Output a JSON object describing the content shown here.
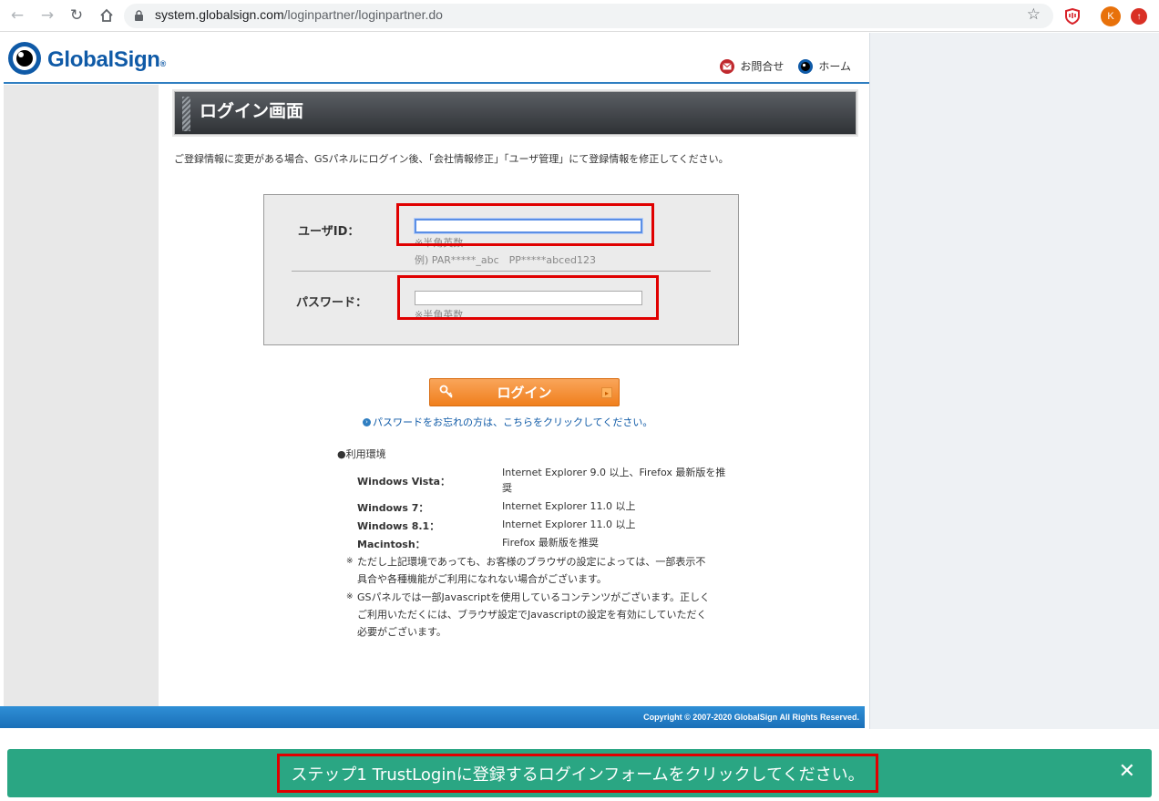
{
  "browser": {
    "url_domain": "system.globalsign.com",
    "url_path": "/loginpartner/loginpartner.do",
    "profile_initial": "K"
  },
  "header": {
    "logo_text": "GlobalSign",
    "logo_mark": "®",
    "links": [
      {
        "label": "お問合せ",
        "icon": "mail-icon"
      },
      {
        "label": "ホーム",
        "icon": "globe-icon"
      }
    ]
  },
  "page": {
    "title": "ログイン画面",
    "notice": "ご登録情報に変更がある場合、GSパネルにログイン後、「会社情報修正」「ユーザ管理」にて登録情報を修正してください。"
  },
  "form": {
    "userid_label": "ユーザID：",
    "userid_value": "",
    "userid_hint": "※半角英数",
    "userid_example": "例) PAR*****_abc　PP*****abced123",
    "password_label": "パスワード：",
    "password_value": "",
    "password_hint": "※半角英数",
    "login_button": "ログイン",
    "forgot_link": "パスワードをお忘れの方は、こちらをクリックしてください。"
  },
  "environment": {
    "title": "●利用環境",
    "rows": [
      {
        "os": "Windows Vista：",
        "value": "Internet Explorer 9.0 以上、Firefox 最新版を推奨"
      },
      {
        "os": "Windows 7：",
        "value": "Internet Explorer 11.0 以上"
      },
      {
        "os": "Windows 8.1：",
        "value": "Internet Explorer 11.0 以上"
      },
      {
        "os": "Macintosh：",
        "value": "Firefox 最新版を推奨"
      }
    ],
    "notes": [
      "ただし上記環境であっても、お客様のブラウザの設定によっては、一部表示不具合や各種機能がご利用になれない場合がございます。",
      "GSパネルでは一部Javascriptを使用しているコンテンツがございます。正しくご利用いただくには、ブラウザ設定でJavascriptの設定を有効にしていただく必要がございます。"
    ],
    "note_marker": "※"
  },
  "footer": {
    "copyright": "Copyright © 2007-2020 GlobalSign All Rights Reserved."
  },
  "banner": {
    "message": "ステップ1 TrustLoginに登録するログインフォームをクリックしてください。",
    "close": "✕"
  },
  "colors": {
    "brand_blue": "#0f5aa7",
    "banner_green": "#2aa683",
    "highlight_red": "#e00000",
    "login_orange": "#f07f1d"
  }
}
